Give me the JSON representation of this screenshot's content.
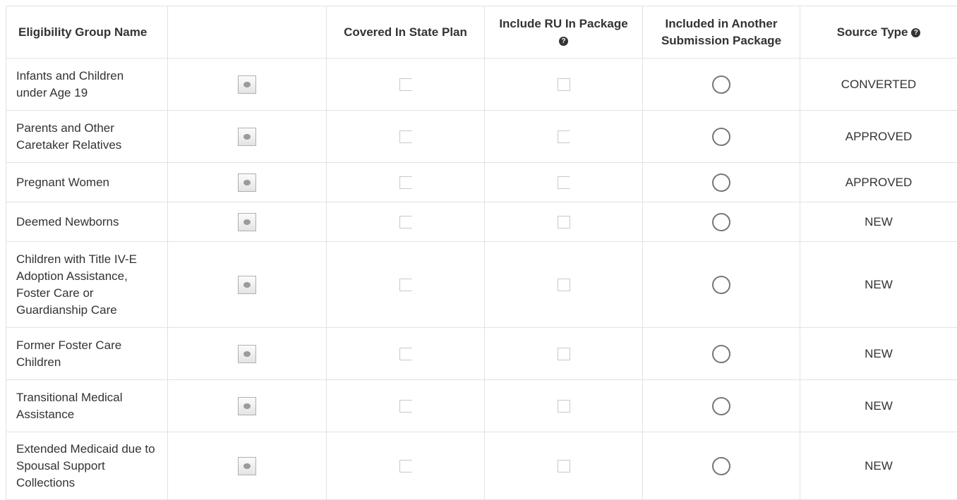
{
  "headers": {
    "name": "Eligibility Group Name",
    "blank": "",
    "covered": "Covered In State Plan",
    "include_ru": "Include RU In Package",
    "included_another": "Included in Another Submission Package",
    "source_type": "Source Type"
  },
  "rows": [
    {
      "name": "Infants and Children under Age 19",
      "source": "CONVERTED"
    },
    {
      "name": "Parents and Other Caretaker Relatives",
      "source": "APPROVED"
    },
    {
      "name": "Pregnant Women",
      "source": "APPROVED"
    },
    {
      "name": "Deemed Newborns",
      "source": "NEW"
    },
    {
      "name": "Children with Title IV-E Adoption Assistance, Foster Care or Guardianship Care",
      "source": "NEW"
    },
    {
      "name": "Former Foster Care Children",
      "source": "NEW"
    },
    {
      "name": "Transitional Medical Assistance",
      "source": "NEW"
    },
    {
      "name": "Extended Medicaid due to Spousal Support Collections",
      "source": "NEW"
    }
  ],
  "icons": {
    "help": "question-circle-icon",
    "comment": "comment-icon"
  }
}
